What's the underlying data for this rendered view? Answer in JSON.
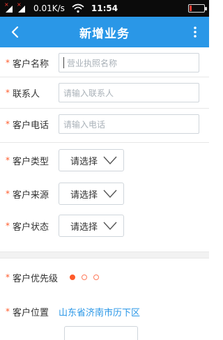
{
  "status_bar": {
    "speed": "0.01K/s",
    "time": "11:54",
    "signal_mark": "×"
  },
  "titlebar": {
    "title": "新增业务"
  },
  "form": {
    "required_mark": "*",
    "customer_name": {
      "label": "客户名称",
      "placeholder": "营业执照名称"
    },
    "contact": {
      "label": "联系人",
      "placeholder": "请输入联系人"
    },
    "phone": {
      "label": "客户电话",
      "placeholder": "请输入电话"
    },
    "customer_type": {
      "label": "客户类型",
      "value": "请选择"
    },
    "customer_source": {
      "label": "客户来源",
      "value": "请选择"
    },
    "customer_status": {
      "label": "客户状态",
      "value": "请选择"
    },
    "priority": {
      "label": "客户优先级",
      "filled": 1,
      "total": 3
    },
    "location": {
      "label": "客户位置",
      "value": "山东省济南市历下区"
    }
  },
  "colors": {
    "header": "#2a97e7",
    "required": "#ff5a2a",
    "link": "#2a97e7"
  }
}
